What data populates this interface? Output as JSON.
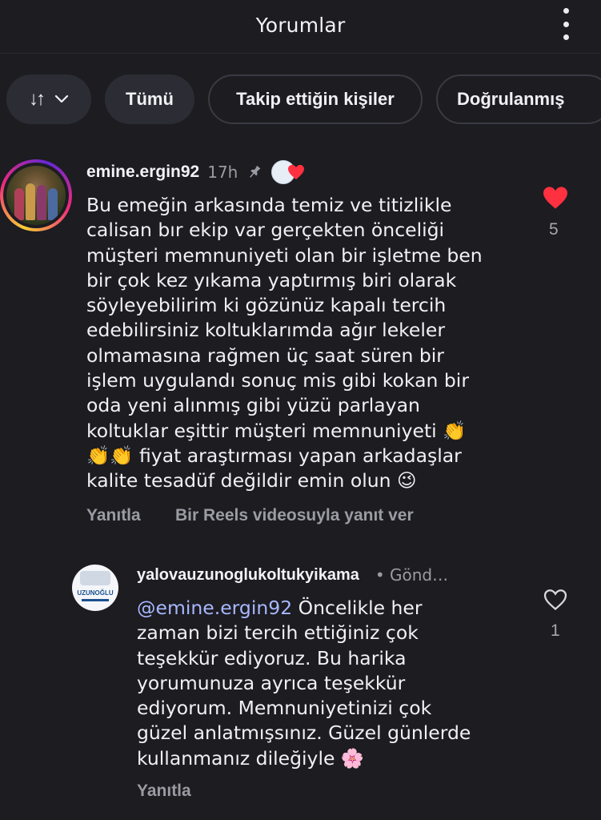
{
  "header": {
    "title": "Yorumlar"
  },
  "filters": {
    "sort_icon": "↓↑",
    "chips": [
      "Tümü",
      "Takip ettiğin kişiler",
      "Doğrulanmış"
    ]
  },
  "comment": {
    "username": "emine.ergin92",
    "time": "17h",
    "pin_icon": "pin-icon",
    "text": "Bu emeğin arkasında temiz ve titizlikle\ncalisan bır ekip var gerçekten önceliği\nmüşteri memnuniyeti olan bir işletme ben\nbir çok kez yıkama yaptırmış biri olarak\nsöyleyebilirim ki gözünüz kapalı tercih\nedebilirsiniz koltuklarımda ağır lekeler\nolmamasına rağmen üç saat süren bir\nişlem uygulandı sonuç mis gibi kokan bir\noda yeni alınmış gibi yüzü parlayan\nkoltuklar eşittir müşteri memnuniyeti 👏\n👏👏 fiyat araştırması yapan arkadaşlar\nkalite tesadüf değildir emin olun 😉",
    "like_count": "5",
    "actions": {
      "reply": "Yanıtla",
      "reels_reply": "Bir Reels videosuyla yanıt ver"
    }
  },
  "reply": {
    "username": "yalovauzunoglukoltukyikama",
    "status": "• Gönd…",
    "avatar_label": "UZUNOĞLU",
    "mention": "@emine.ergin92",
    "text": " Öncelikle her\nzaman bizi tercih ettiğiniz çok\nteşekkür ediyoruz. Bu harika\nyorumunuza ayrıca teşekkür\nediyorum. Memnuniyetinizi çok\ngüzel anlatmışsınız. Güzel günlerde\nkullanmanız dileğiyle 🌸",
    "like_count": "1",
    "actions": {
      "reply": "Yanıtla"
    }
  },
  "colors": {
    "background": "#1c1c21",
    "like_red": "#ff3040",
    "mention_blue": "#a8b7ff",
    "muted": "#9b9ba3"
  }
}
